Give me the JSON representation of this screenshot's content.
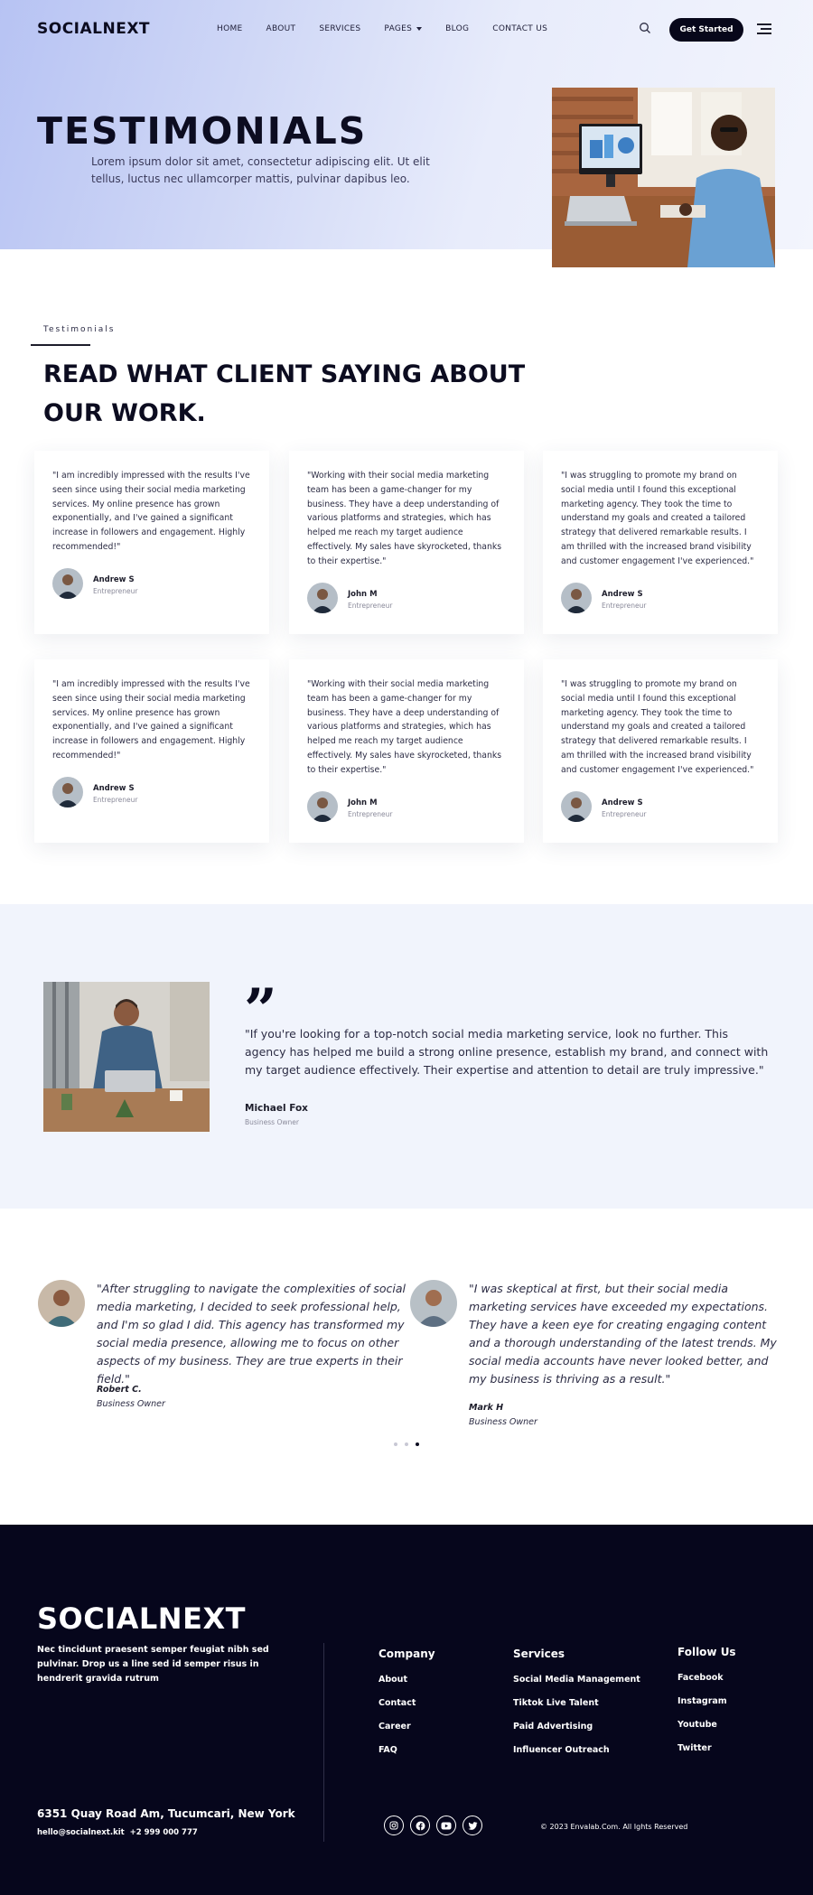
{
  "nav": {
    "logo": "SOCIALNEXT",
    "items": [
      {
        "label": "HOME"
      },
      {
        "label": "ABOUT"
      },
      {
        "label": "SERVICES"
      },
      {
        "label": "PAGES",
        "dropdown": true
      },
      {
        "label": "BLOG"
      },
      {
        "label": "CONTACT US"
      }
    ],
    "cta": "Get Started",
    "icons": {
      "search": "search-icon",
      "menu": "hamburger-menu-icon"
    }
  },
  "hero": {
    "title": "TESTIMONIALS",
    "subtitle": "Lorem ipsum dolor sit amet, consectetur adipiscing elit. Ut elit tellus, luctus nec ullamcorper mattis, pulvinar dapibus leo."
  },
  "section": {
    "eyebrow": "Testimonials",
    "title": "READ WHAT CLIENT SAYING ABOUT OUR WORK."
  },
  "cards": [
    {
      "quote": "\"I am incredibly impressed with the results I've seen since using their social media marketing services. My online presence has grown exponentially, and I've gained a significant increase in followers and engagement. Highly recommended!\"",
      "name": "Andrew S",
      "role": "Entrepreneur"
    },
    {
      "quote": "\"Working with their social media marketing team has been a game-changer for my business. They have a deep understanding of various platforms and strategies, which has helped me reach my target audience effectively. My sales have skyrocketed, thanks to their expertise.\"",
      "name": "John M",
      "role": "Entrepreneur"
    },
    {
      "quote": "\"I was struggling to promote my brand on social media until I found this exceptional marketing agency. They took the time to understand my goals and created a tailored strategy that delivered remarkable results. I am thrilled with the increased brand visibility and customer engagement I've experienced.\"",
      "name": "Andrew S",
      "role": "Entrepreneur"
    },
    {
      "quote": "\"I am incredibly impressed with the results I've seen since using their social media marketing services. My online presence has grown exponentially, and I've gained a significant increase in followers and engagement. Highly recommended!\"",
      "name": "Andrew S",
      "role": "Entrepreneur"
    },
    {
      "quote": "\"Working with their social media marketing team has been a game-changer for my business. They have a deep understanding of various platforms and strategies, which has helped me reach my target audience effectively. My sales have skyrocketed, thanks to their expertise.\"",
      "name": "John M",
      "role": "Entrepreneur"
    },
    {
      "quote": "\"I was struggling to promote my brand on social media until I found this exceptional marketing agency. They took the time to understand my goals and created a tailored strategy that delivered remarkable results. I am thrilled with the increased brand visibility and customer engagement I've experienced.\"",
      "name": "Andrew S",
      "role": "Entrepreneur"
    }
  ],
  "featured": {
    "quote": "\"If you're looking for a top-notch social media marketing service, look no further. This agency has helped me build a strong online presence, establish my brand, and connect with my target audience effectively. Their expertise and attention to detail are truly impressive.\"",
    "name": "Michael Fox",
    "role": "Business Owner"
  },
  "slider": {
    "slides": [
      {
        "quote": "\"After struggling to navigate the complexities of social media marketing, I decided to seek professional help, and I'm so glad I did. This agency has transformed my social media presence, allowing me to focus on other aspects of my business. They are true experts in their field.\"",
        "name": "Robert C.",
        "role": "Business Owner"
      },
      {
        "quote": "\"I was skeptical at first, but their social media marketing services have exceeded my expectations. They have a keen eye for creating engaging content and a thorough understanding of the latest trends. My social media accounts have never looked better, and my business is thriving as a result.\"",
        "name": "Mark H",
        "role": "Business Owner"
      }
    ],
    "dot_count": 3,
    "active_dot": 3
  },
  "footer": {
    "logo": "SOCIALNEXT",
    "about": "Nec tincidunt praesent semper feugiat nibh sed pulvinar. Drop us a line sed id semper risus in hendrerit gravida rutrum",
    "columns": [
      {
        "title": "Company",
        "links": [
          "About",
          "Contact",
          "Career",
          "FAQ"
        ]
      },
      {
        "title": "Services",
        "links": [
          "Social Media Management",
          "Tiktok Live Talent",
          "Paid Advertising",
          "Influencer Outreach"
        ]
      },
      {
        "title": "Follow Us",
        "links": [
          "Facebook",
          "Instagram",
          "Youtube",
          "Twitter"
        ]
      }
    ],
    "address": "6351 Quay Road Am, Tucumcari, New York",
    "email": "hello@socialnext.kit",
    "phone": "+2 999 000 777",
    "social_icons": [
      "instagram-icon",
      "facebook-icon",
      "youtube-icon",
      "twitter-icon"
    ],
    "copyright": "© 2023 Envalab.Com. All Ights Reserved"
  },
  "colors": {
    "dark": "#06061c",
    "hero_start": "#b7c3f3",
    "featured_bg": "#f1f4fc",
    "accent": "#2f6df0"
  }
}
